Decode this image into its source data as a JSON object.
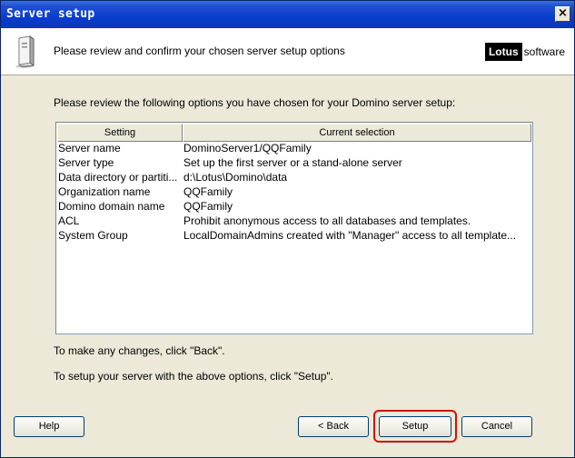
{
  "window": {
    "title": "Server setup",
    "close_glyph": "×"
  },
  "header": {
    "icon": "server-icon",
    "text": "Please review and confirm your chosen server setup options",
    "logo": {
      "brand": "Lotus",
      "suffix": "software"
    }
  },
  "intro": "Please review the following options you have chosen for your Domino server setup:",
  "table": {
    "columns": [
      "Setting",
      "Current selection"
    ],
    "rows": [
      {
        "setting": "Server name",
        "value": "DominoServer1/QQFamily"
      },
      {
        "setting": "Server type",
        "value": "Set up the first server or a stand-alone server"
      },
      {
        "setting": "Data directory or partiti...",
        "value": "d:\\Lotus\\Domino\\data"
      },
      {
        "setting": "Organization name",
        "value": "QQFamily"
      },
      {
        "setting": "Domino domain name",
        "value": "QQFamily"
      },
      {
        "setting": "ACL",
        "value": "Prohibit  anonymous access to all databases and templates."
      },
      {
        "setting": "System Group",
        "value": "LocalDomainAdmins created with \"Manager\" access to all template..."
      }
    ]
  },
  "notes": {
    "change": "To make any changes, click \"Back\".",
    "setup": "To setup your server with the above options, click \"Setup\"."
  },
  "buttons": {
    "help": "Help",
    "back": "< Back",
    "setup": "Setup",
    "cancel": "Cancel"
  }
}
